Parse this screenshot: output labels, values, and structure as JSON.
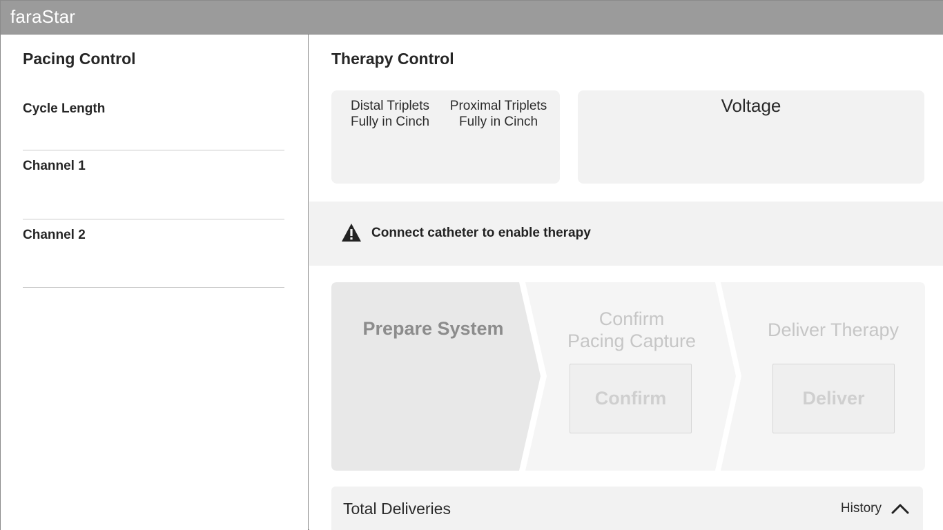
{
  "app": {
    "title": "faraStar"
  },
  "pacing": {
    "heading": "Pacing Control",
    "cycle_length_label": "Cycle Length",
    "channel1_label": "Channel 1",
    "channel2_label": "Channel 2"
  },
  "therapy": {
    "heading": "Therapy Control",
    "distal": {
      "line1": "Distal Triplets",
      "line2": "Fully in Cinch"
    },
    "proximal": {
      "line1": "Proximal Triplets",
      "line2": "Fully in Cinch"
    },
    "voltage_label": "Voltage",
    "alert": {
      "icon": "warning-icon",
      "text": "Connect catheter to enable therapy"
    },
    "steps": {
      "prepare": {
        "title": "Prepare System"
      },
      "confirm": {
        "title_line1": "Confirm",
        "title_line2": "Pacing Capture",
        "button": "Confirm"
      },
      "deliver": {
        "title": "Deliver Therapy",
        "button": "Deliver"
      }
    },
    "deliveries": {
      "label": "Total Deliveries",
      "history_label": "History",
      "history_icon": "chevron-up-icon"
    }
  },
  "colors": {
    "titlebar": "#9b9b9b",
    "panel_bg": "#f2f2f2",
    "step_active": "#e8e8e8",
    "step_inactive": "#f5f5f5",
    "disabled_text": "#c6c6c6"
  }
}
